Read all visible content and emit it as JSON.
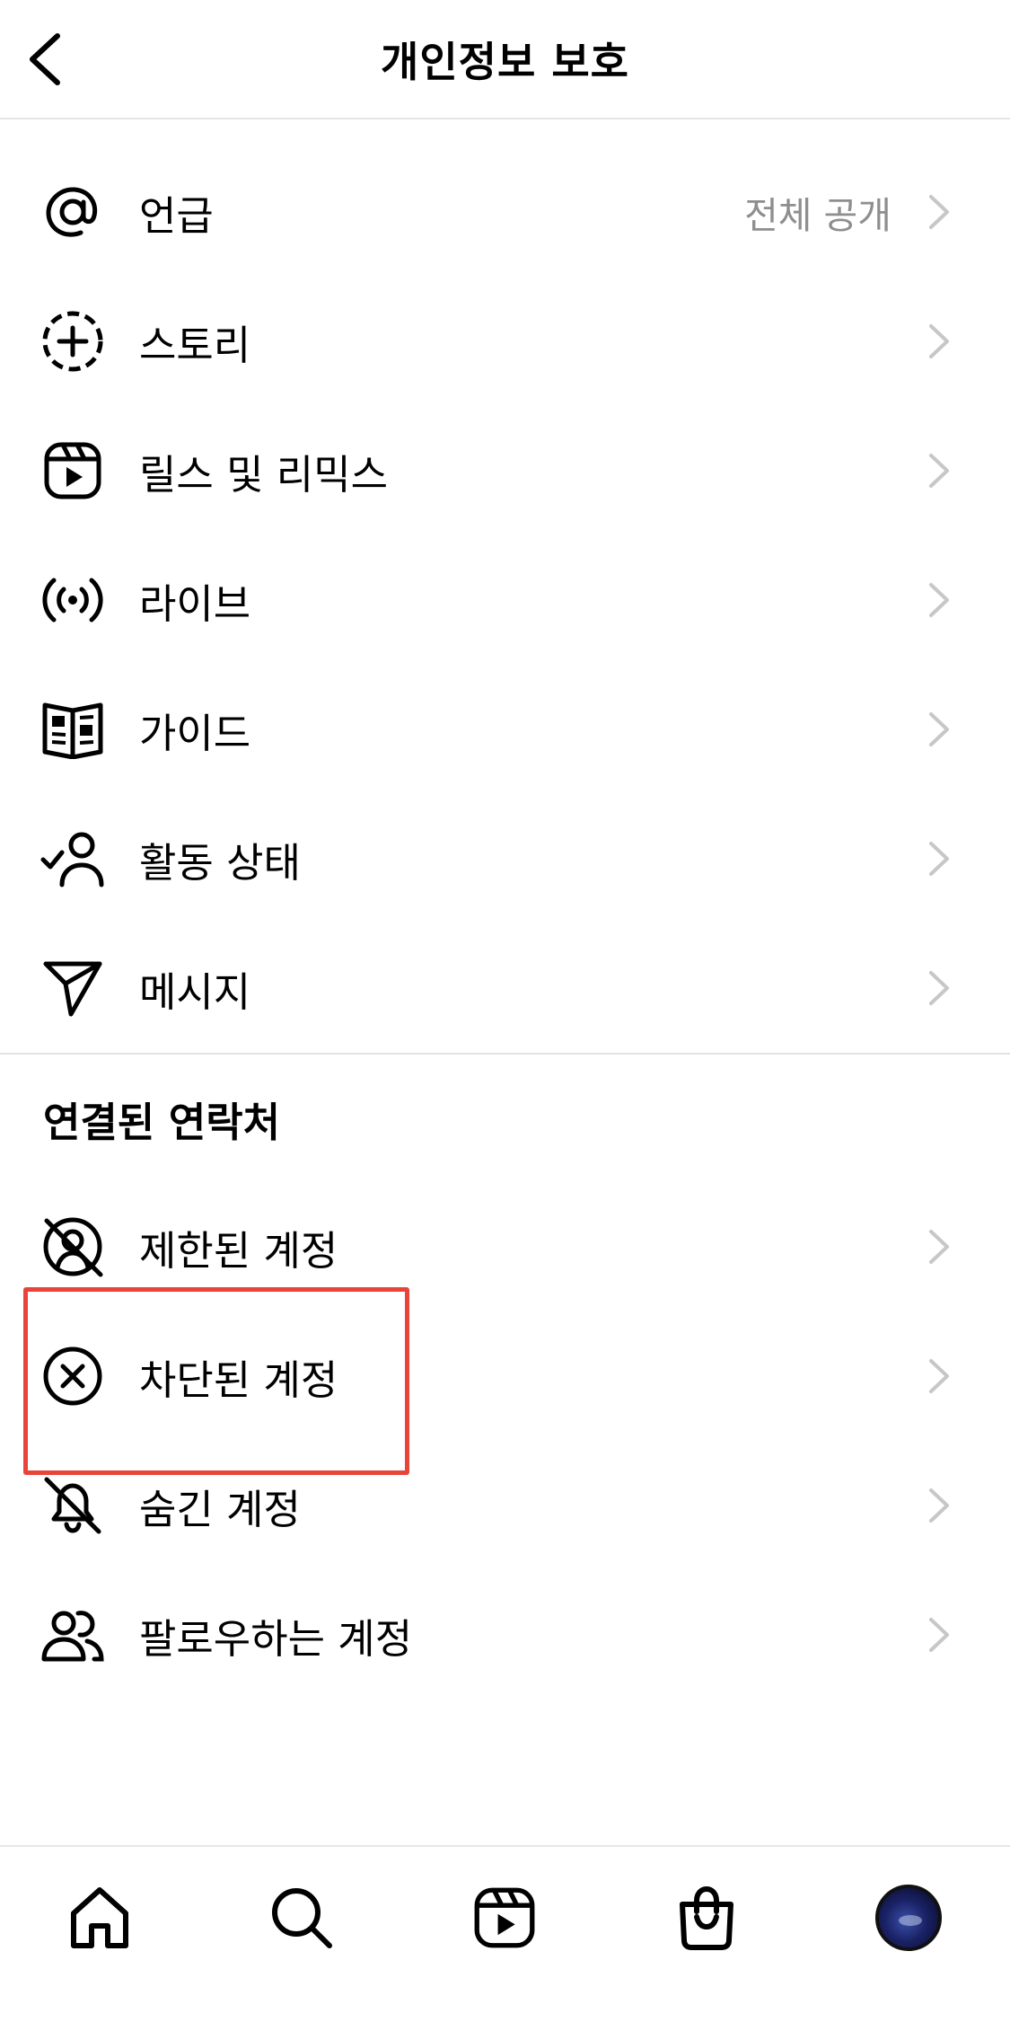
{
  "header": {
    "title": "개인정보 보호",
    "back_icon": "chevron-left-icon"
  },
  "settings": [
    {
      "label": "언급",
      "value": "전체 공개",
      "icon": "at-icon"
    },
    {
      "label": "스토리",
      "icon": "story-add-icon"
    },
    {
      "label": "릴스 및 리믹스",
      "icon": "reels-icon"
    },
    {
      "label": "라이브",
      "icon": "live-broadcast-icon"
    },
    {
      "label": "가이드",
      "icon": "guide-book-icon"
    },
    {
      "label": "활동 상태",
      "icon": "activity-status-icon"
    },
    {
      "label": "메시지",
      "icon": "send-icon"
    }
  ],
  "connections": {
    "title": "연결된 연락처",
    "items": [
      {
        "label": "제한된 계정",
        "icon": "restricted-icon"
      },
      {
        "label": "차단된 계정",
        "icon": "blocked-icon"
      },
      {
        "label": "숨긴 계정",
        "icon": "muted-bell-icon"
      },
      {
        "label": "팔로우하는 계정",
        "icon": "following-people-icon"
      }
    ]
  },
  "tabbar": [
    "home-icon",
    "search-icon",
    "reels-icon",
    "shop-icon",
    "profile-avatar"
  ],
  "colors": {
    "highlight": "#e8443a",
    "secondary_text": "#8e8e8e",
    "chevron": "#c7c7c7"
  }
}
